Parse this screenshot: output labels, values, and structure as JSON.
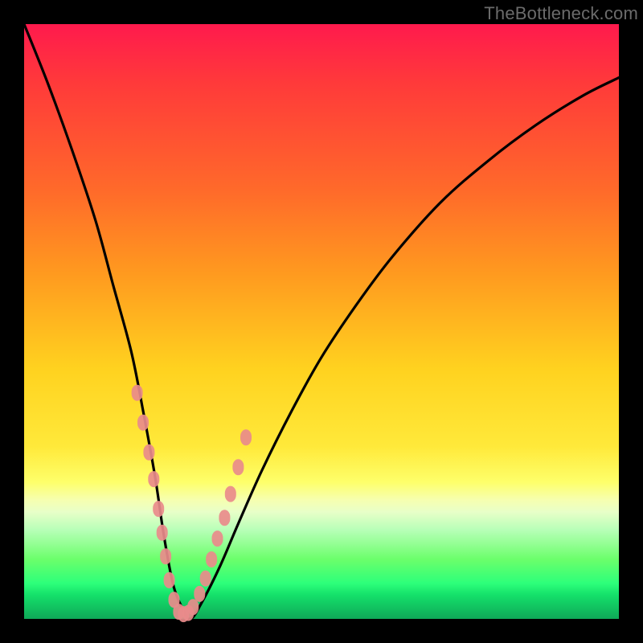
{
  "watermark": "TheBottleneck.com",
  "chart_data": {
    "type": "line",
    "title": "",
    "xlabel": "",
    "ylabel": "",
    "xlim": [
      0,
      100
    ],
    "ylim": [
      0,
      100
    ],
    "series": [
      {
        "name": "bottleneck-curve",
        "x": [
          0,
          4,
          8,
          12,
          15,
          18,
          20,
          22,
          23.5,
          25,
          26.5,
          28,
          30,
          33,
          36,
          40,
          45,
          50,
          56,
          62,
          70,
          78,
          86,
          94,
          100
        ],
        "y": [
          100,
          90,
          79,
          67,
          56,
          45,
          35,
          24,
          14,
          6,
          2,
          0,
          3,
          9,
          16,
          25,
          35,
          44,
          53,
          61,
          70,
          77,
          83,
          88,
          91
        ]
      }
    ],
    "markers": {
      "name": "data-points",
      "x": [
        19.0,
        20.0,
        21.0,
        21.8,
        22.6,
        23.2,
        23.8,
        24.4,
        25.2,
        26.0,
        26.8,
        27.6,
        28.4,
        29.5,
        30.5,
        31.5,
        32.5,
        33.7,
        34.7,
        36.0,
        37.3
      ],
      "y": [
        38.0,
        33.0,
        28.0,
        23.5,
        18.5,
        14.5,
        10.5,
        6.5,
        3.2,
        1.2,
        0.8,
        1.0,
        2.0,
        4.2,
        6.8,
        10.0,
        13.5,
        17.0,
        21.0,
        25.5,
        30.5
      ]
    },
    "gradient_stops": [
      {
        "pos": 0,
        "color": "#ff1a4d"
      },
      {
        "pos": 28,
        "color": "#ff6a2a"
      },
      {
        "pos": 58,
        "color": "#ffd21f"
      },
      {
        "pos": 77,
        "color": "#feff6a"
      },
      {
        "pos": 94,
        "color": "#2dff7a"
      },
      {
        "pos": 100,
        "color": "#0fa858"
      }
    ],
    "marker_color": "#e98b8b",
    "curve_color": "#000000"
  }
}
